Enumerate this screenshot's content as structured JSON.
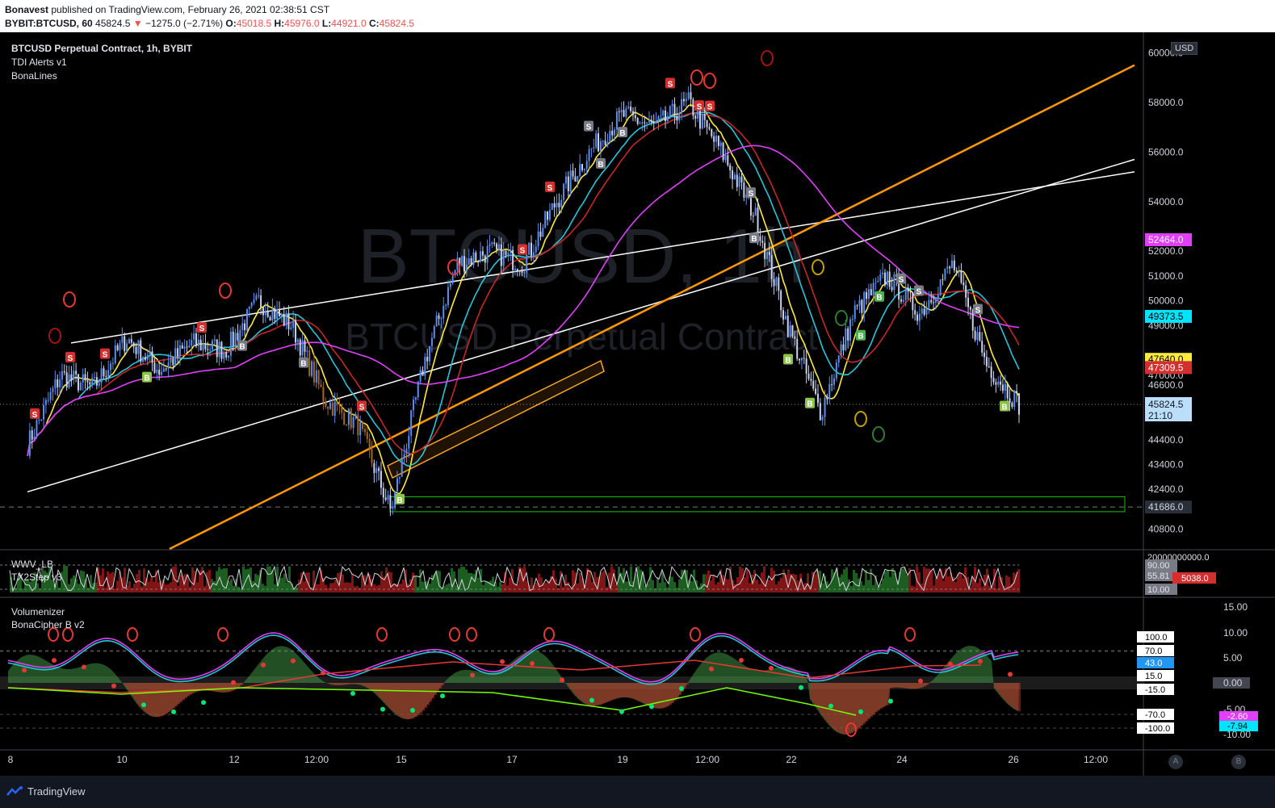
{
  "header": {
    "publisher": "Bonavest",
    "published_line": "published on TradingView.com, February 26, 2021 02:38:51 CST",
    "symbol": "BYBIT:BTCUSD, 60",
    "last": "45824.5",
    "change": "−1275.0 (−2.71%)",
    "o_label": "O:",
    "o": "45018.5",
    "h_label": "H:",
    "h": "45976.0",
    "l_label": "L:",
    "l": "44921.0",
    "c_label": "C:",
    "c": "45824.5"
  },
  "legend": {
    "title": "BTCUSD Perpetual Contract, 1h, BYBIT",
    "ind1": "TDI Alerts v1",
    "ind2": "BonaLines",
    "watermark_big": "BTCUSD, 1h",
    "watermark_small": "BTCUSD Perpetual Contract"
  },
  "pane2": {
    "ind1": "WWV_LB",
    "ind2": "TX2Step v3"
  },
  "pane3": {
    "ind1": "Volumenizer",
    "ind2": "BonaCipher B v2"
  },
  "currency_button": "USD",
  "price_axis": [
    "60000.0",
    "58000.0",
    "56000.0",
    "54000.0",
    "52000.0",
    "51000.0",
    "50000.0",
    "49000.0",
    "47000.0",
    "46600.0",
    "44400.0",
    "43400.0",
    "42400.0",
    "40800.0"
  ],
  "price_tags": {
    "magenta": "52464.0",
    "cyan": "49373.5",
    "yellow": "47640.0",
    "red": "47309.5",
    "last": "45824.5",
    "countdown": "21:10",
    "support": "41686.0"
  },
  "pane2_axis": [
    "20000000000.0",
    "90.00",
    "55.81",
    "10.00"
  ],
  "pane2_tag": "5038.0",
  "pane3_axis": [
    "15.00",
    "10.00",
    "5.00",
    "0.00",
    "-5.00",
    "-10.00"
  ],
  "pane3_levels": [
    "100.0",
    "70.0",
    "43.0",
    "15.0",
    "-15.0",
    "-70.0",
    "-100.0"
  ],
  "pane3_tags": {
    "magenta": "-2.60",
    "cyan": "-7.94"
  },
  "time_axis": [
    "8",
    "10",
    "12",
    "12:00",
    "15",
    "17",
    "19",
    "12:00",
    "22",
    "24",
    "26",
    "12:00"
  ],
  "footer": {
    "brand": "TradingView",
    "btn_a": "A",
    "btn_b": "B"
  },
  "colors": {
    "candle_up": "#5b8def",
    "candle_down": "#ffffff",
    "yellow": "#ffeb3b",
    "cyan": "#26c6da",
    "magenta": "#e040fb",
    "orange": "#ff9800",
    "red": "#c62828",
    "green": "#4caf50"
  },
  "chart_data": {
    "type": "candlestick",
    "title": "BTCUSD Perpetual Contract, 1h, BYBIT",
    "x": [
      "8",
      "10",
      "12",
      "12:00",
      "15",
      "17",
      "19",
      "12:00",
      "22",
      "24",
      "26"
    ],
    "close_path": [
      44200,
      47000,
      46500,
      48500,
      47200,
      48300,
      48000,
      50000,
      49000,
      46000,
      45000,
      41500,
      47500,
      51500,
      52000,
      51500,
      54000,
      56000,
      57500,
      57000,
      58000,
      56000,
      53500,
      49000,
      45500,
      49500,
      51000,
      49500,
      51500,
      47500,
      45824.5
    ],
    "ylim": [
      40000,
      60500
    ],
    "signals": {
      "sell": "S",
      "buy": "B"
    },
    "support_zone": [
      41500,
      42100
    ]
  }
}
